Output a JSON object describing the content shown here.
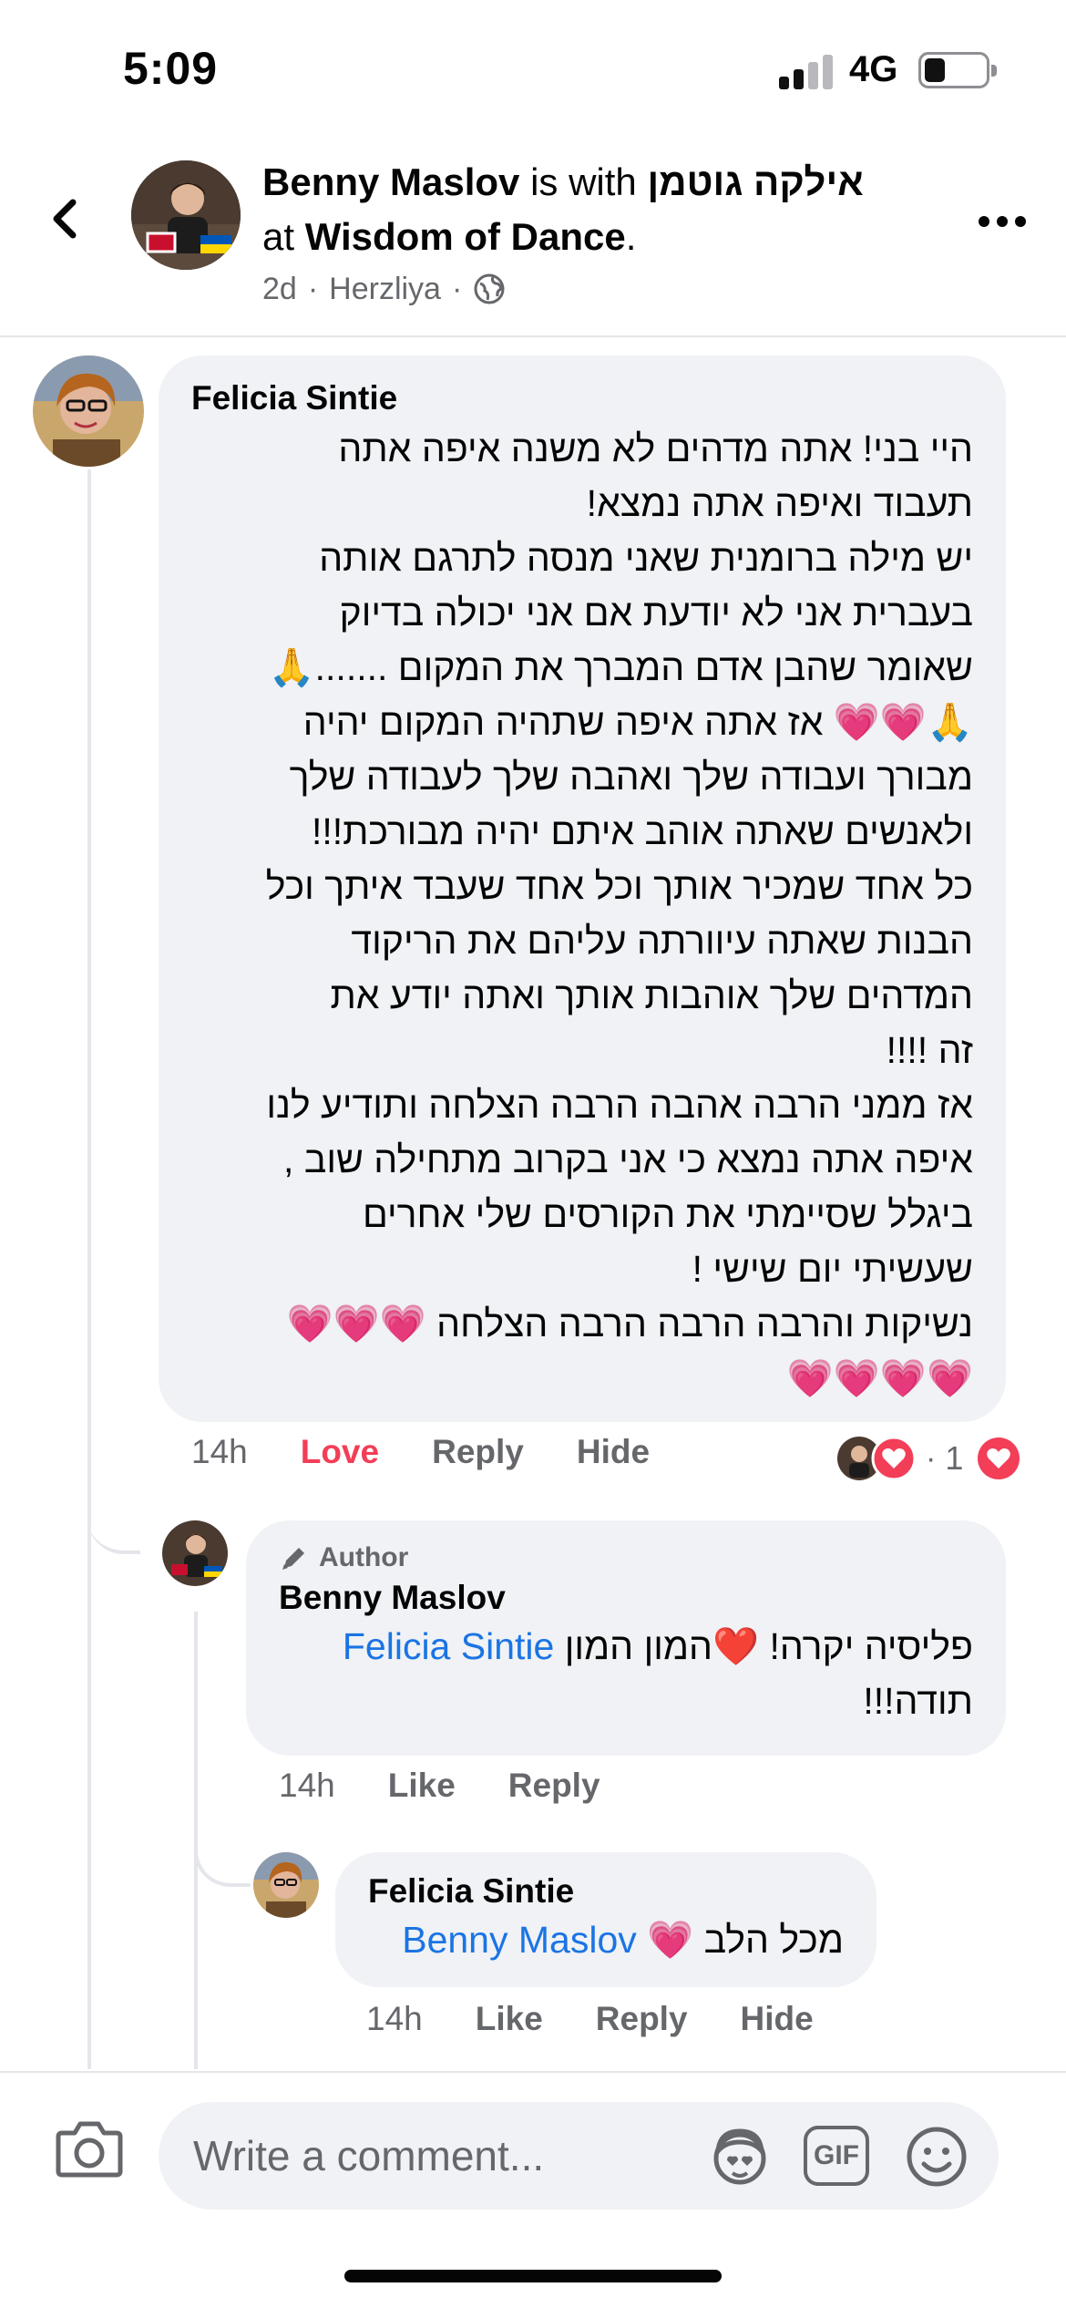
{
  "status_bar": {
    "time": "5:09",
    "network": "4G",
    "battery_level": 0.35
  },
  "post_header": {
    "author": "Benny Maslov",
    "with_text": "is with",
    "tagged": "אילקה גוטמן",
    "at_text": "at",
    "place": "Wisdom of Dance",
    "period": ".",
    "time": "2d",
    "location": "Herzliya",
    "separator": "·",
    "audience_icon": "globe-icon"
  },
  "comments": [
    {
      "author": "Felicia Sintie",
      "lines": [
        "היי בני! אתה מדהים לא משנה איפה אתה",
        "תעבוד ואיפה אתה נמצא!",
        "יש מילה ברומנית שאני מנסה לתרגם אותה",
        "בעברית אני לא יודעת אם אני יכולה בדיוק",
        "שאומר שהבן אדם המברך את המקום .......🙏",
        "🙏💗💗 אז אתה איפה שתהיה המקום יהיה",
        "מבורך ועבודה שלך ואהבה שלך לעבודה שלך",
        "ולאנשים שאתה אוהב איתם יהיה מבורכת!!!",
        "כל אחד שמכיר אותך וכל אחד שעבד איתך וכל",
        "הבנות שאתה   עיוורתה עליהם את הריקוד",
        "המדהים שלך אוהבות אותך ואתה יודע את",
        "זה !!!!",
        "אז ממני הרבה אהבה הרבה הצלחה ותודיע לנו",
        "איפה אתה נמצא כי אני בקרוב מתחילה שוב ,",
        "ביגלל  שסיימתי  את הקורסים שלי אחרים",
        "שעשיתי יום שישי !",
        "נשיקות והרבה הרבה הרבה הצלחה 💗💗💗",
        "💗💗💗💗"
      ],
      "time": "14h",
      "actions": [
        "Love",
        "Reply",
        "Hide"
      ],
      "reaction_count": "1",
      "reaction_separator": "·"
    },
    {
      "badge": "Author",
      "author": "Benny Maslov",
      "mention": "Felicia Sintie",
      "text_line1": "פליסיה יקרה! ❤️המון המון",
      "text_line2": "תודה!!!",
      "time": "14h",
      "actions": [
        "Like",
        "Reply"
      ]
    },
    {
      "author": "Felicia Sintie",
      "mention": "Benny Maslov",
      "text": "מכל הלב 💗",
      "time": "14h",
      "actions": [
        "Like",
        "Reply",
        "Hide"
      ]
    }
  ],
  "composer": {
    "placeholder": "Write a comment...",
    "gif_label": "GIF"
  },
  "colors": {
    "love": "#f33e58",
    "mention": "#1b74e4",
    "heart_emoji": "#ff2d9b",
    "bubble": "#f0f2f5"
  }
}
